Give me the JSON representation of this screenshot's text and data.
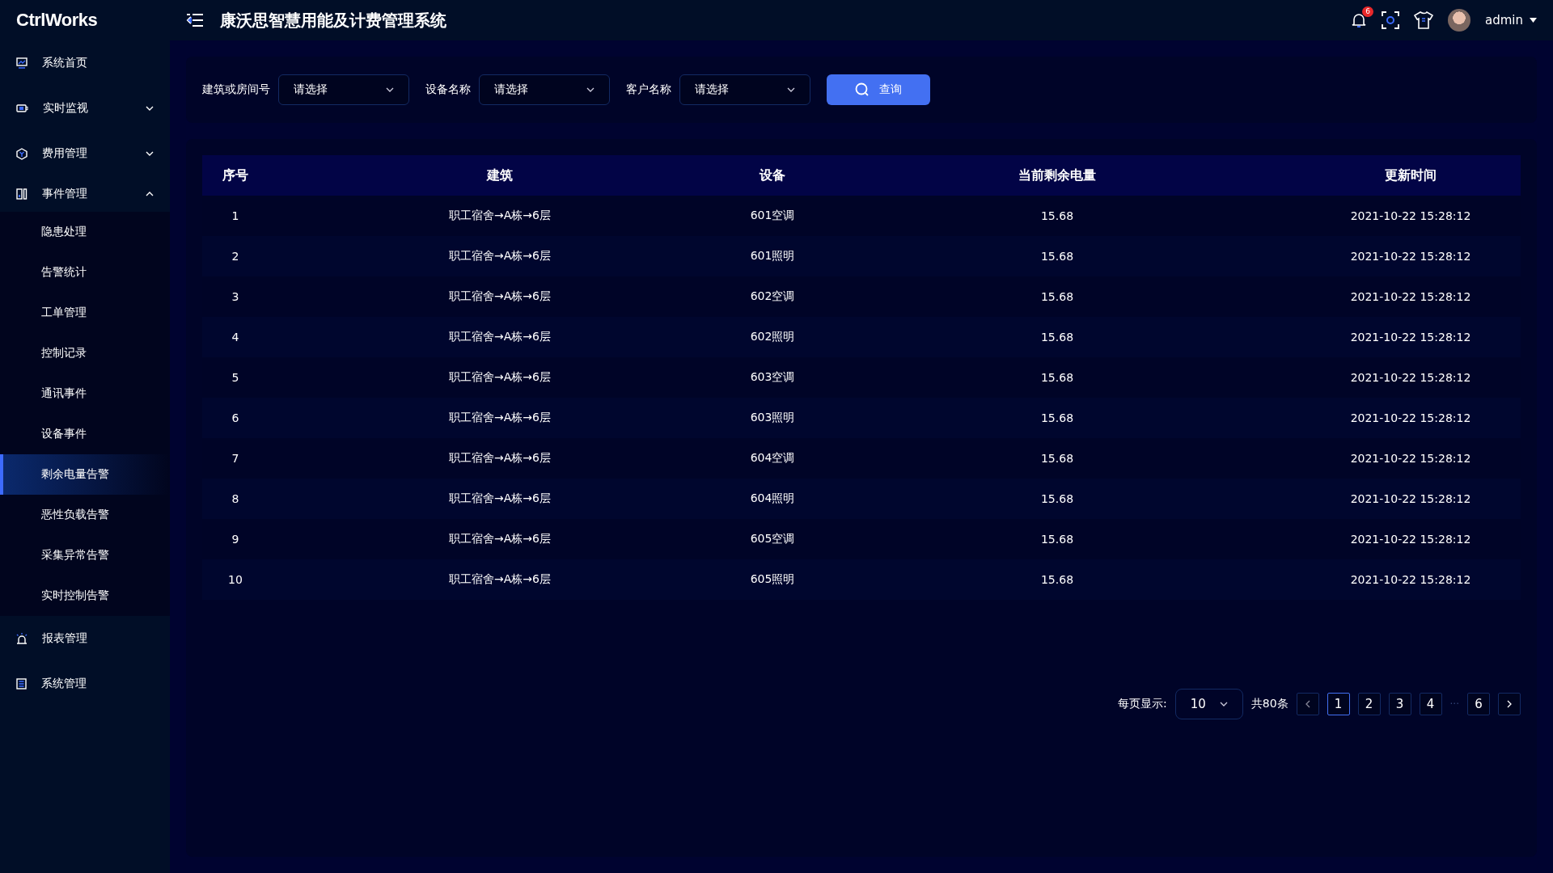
{
  "header": {
    "logo": "CtrlWorks",
    "title": "康沃思智慧用能及计费管理系统",
    "notifications": "6",
    "user": "admin"
  },
  "sidebar": {
    "items": [
      {
        "kind": "link",
        "label": "系统首页"
      },
      {
        "kind": "menu",
        "label": "实时监视",
        "expanded": false
      },
      {
        "kind": "menu",
        "label": "费用管理",
        "expanded": false
      },
      {
        "kind": "menu",
        "label": "事件管理",
        "expanded": true,
        "children": [
          {
            "label": "隐患处理",
            "selected": false
          },
          {
            "label": "告警统计",
            "selected": false
          },
          {
            "label": "工单管理",
            "selected": false
          },
          {
            "label": "控制记录",
            "selected": false
          },
          {
            "label": "通讯事件",
            "selected": false
          },
          {
            "label": "设备事件",
            "selected": false
          },
          {
            "label": "剩余电量告警",
            "selected": true
          },
          {
            "label": "恶性负载告警",
            "selected": false
          },
          {
            "label": "采集异常告警",
            "selected": false
          },
          {
            "label": "实时控制告警",
            "selected": false
          }
        ]
      },
      {
        "kind": "link",
        "label": "报表管理"
      },
      {
        "kind": "link",
        "label": "系统管理"
      }
    ]
  },
  "filters": [
    {
      "label": "建筑或房间号",
      "placeholder": "请选择"
    },
    {
      "label": "设备名称",
      "placeholder": "请选择"
    },
    {
      "label": "客户名称",
      "placeholder": "请选择"
    }
  ],
  "query_button": "查询",
  "table": {
    "columns": [
      "序号",
      "建筑",
      "设备",
      "当前剩余电量",
      "更新时间"
    ],
    "rows": [
      [
        "1",
        "职工宿舍→A栋→6层",
        "601空调",
        "15.68",
        "2021-10-22 15:28:12"
      ],
      [
        "2",
        "职工宿舍→A栋→6层",
        "601照明",
        "15.68",
        "2021-10-22 15:28:12"
      ],
      [
        "3",
        "职工宿舍→A栋→6层",
        "602空调",
        "15.68",
        "2021-10-22 15:28:12"
      ],
      [
        "4",
        "职工宿舍→A栋→6层",
        "602照明",
        "15.68",
        "2021-10-22 15:28:12"
      ],
      [
        "5",
        "职工宿舍→A栋→6层",
        "603空调",
        "15.68",
        "2021-10-22 15:28:12"
      ],
      [
        "6",
        "职工宿舍→A栋→6层",
        "603照明",
        "15.68",
        "2021-10-22 15:28:12"
      ],
      [
        "7",
        "职工宿舍→A栋→6层",
        "604空调",
        "15.68",
        "2021-10-22 15:28:12"
      ],
      [
        "8",
        "职工宿舍→A栋→6层",
        "604照明",
        "15.68",
        "2021-10-22 15:28:12"
      ],
      [
        "9",
        "职工宿舍→A栋→6层",
        "605空调",
        "15.68",
        "2021-10-22 15:28:12"
      ],
      [
        "10",
        "职工宿舍→A栋→6层",
        "605照明",
        "15.68",
        "2021-10-22 15:28:12"
      ]
    ]
  },
  "pagination": {
    "page_size_label": "每页显示:",
    "page_size": "10",
    "total": "共80条",
    "pages": [
      {
        "kind": "page",
        "label": "1",
        "selected": true
      },
      {
        "kind": "page",
        "label": "2",
        "selected": false
      },
      {
        "kind": "page",
        "label": "3",
        "selected": false
      },
      {
        "kind": "page",
        "label": "4",
        "selected": false
      },
      {
        "kind": "gap",
        "label": "···"
      },
      {
        "kind": "page",
        "label": "6",
        "selected": false
      }
    ]
  }
}
